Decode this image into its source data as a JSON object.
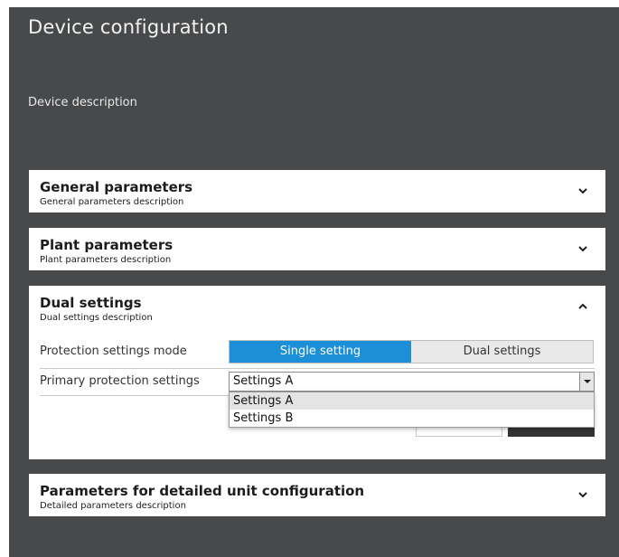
{
  "page": {
    "title": "Device configuration",
    "description": "Device description"
  },
  "panels": [
    {
      "title": "General parameters",
      "description": "General parameters description",
      "expanded": false
    },
    {
      "title": "Plant parameters",
      "description": "Plant parameters description",
      "expanded": false
    },
    {
      "title": "Dual settings",
      "description": "Dual settings description",
      "expanded": true
    },
    {
      "title": "Parameters for detailed unit configuration",
      "description": "Detailed parameters description",
      "expanded": false
    }
  ],
  "dual_settings": {
    "mode_label": "Protection settings mode",
    "mode_options": [
      "Single setting",
      "Dual settings"
    ],
    "mode_selected": "Single setting",
    "primary_label": "Primary protection settings",
    "primary_value": "Settings A",
    "dropdown_options": [
      "Settings A",
      "Settings B"
    ],
    "dropdown_highlighted": "Settings A"
  },
  "colors": {
    "background": "#47494b",
    "accent": "#1b8fd8",
    "panel": "#ffffff"
  },
  "icons": {
    "collapsed": "chevron-down-icon",
    "expanded": "chevron-up-icon",
    "select": "caret-down-icon"
  }
}
